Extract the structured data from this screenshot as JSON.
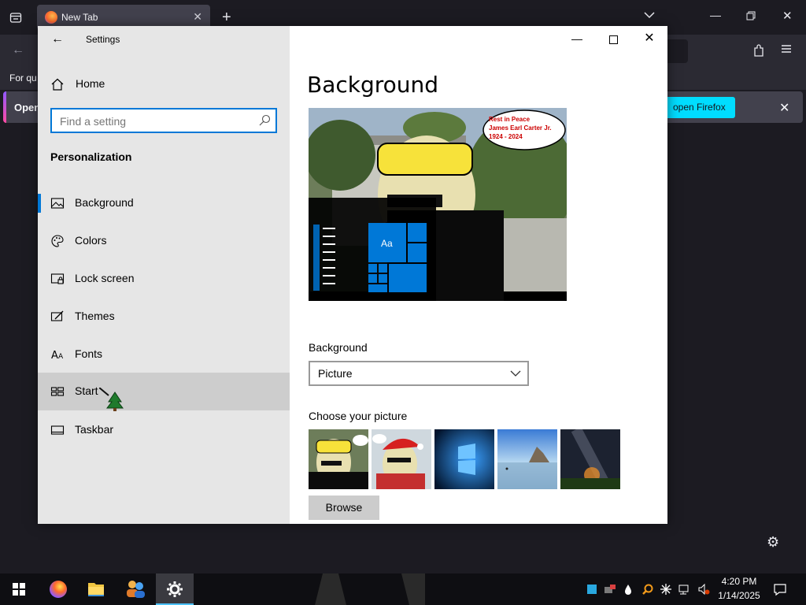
{
  "firefox": {
    "tab_title": "New Tab",
    "bookmark_text": "For qu",
    "notification_text": "Open",
    "notification_button": "open Firefox"
  },
  "settings": {
    "window_title": "Settings",
    "home_label": "Home",
    "search_placeholder": "Find a setting",
    "section_title": "Personalization",
    "nav_items": [
      {
        "label": "Background",
        "icon": "picture-icon",
        "selected": true
      },
      {
        "label": "Colors",
        "icon": "palette-icon"
      },
      {
        "label": "Lock screen",
        "icon": "lock-screen-icon"
      },
      {
        "label": "Themes",
        "icon": "themes-icon"
      },
      {
        "label": "Fonts",
        "icon": "fonts-icon"
      },
      {
        "label": "Start",
        "icon": "start-icon",
        "hovered": true
      },
      {
        "label": "Taskbar",
        "icon": "taskbar-icon"
      }
    ],
    "page_heading": "Background",
    "preview": {
      "bubble_line1": "Rest in Peace",
      "bubble_line2": "James Earl Carter Jr.",
      "bubble_line3": "1924 - 2024",
      "tile_text": "Aa"
    },
    "background_label": "Background",
    "background_value": "Picture",
    "choose_picture_label": "Choose your picture",
    "browse_label": "Browse"
  },
  "taskbar": {
    "time": "4:20 PM",
    "date": "1/14/2025"
  },
  "colors": {
    "accent": "#0078d7",
    "firefox_button": "#00ddff"
  }
}
